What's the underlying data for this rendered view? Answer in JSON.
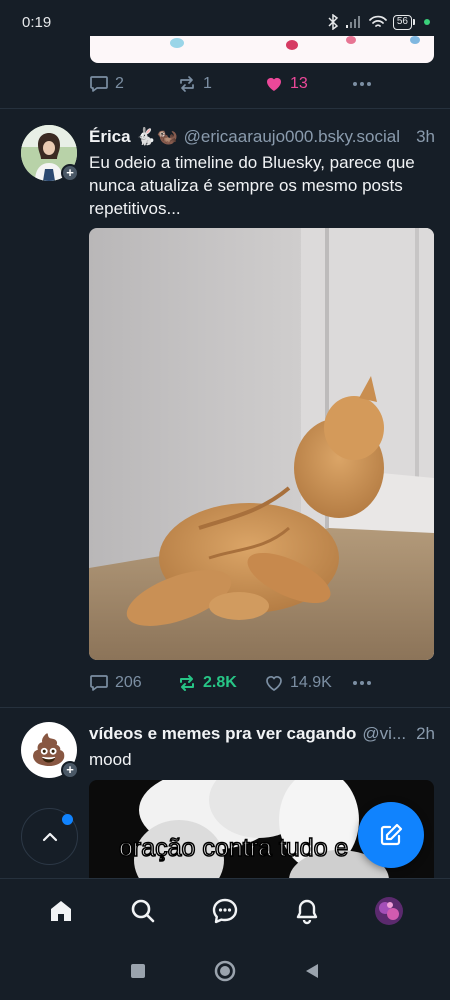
{
  "status_bar": {
    "time": "0:19",
    "battery": "56",
    "icons": [
      "bluetooth-icon",
      "signal-icon",
      "wifi-icon",
      "battery-icon"
    ]
  },
  "previous_post": {
    "replies": "2",
    "reposts": "1",
    "likes": "13",
    "liked": true
  },
  "post1": {
    "display_name": "Érica 🐇🦦",
    "handle": "@ericaaraujo000.bsky.social",
    "timestamp": "3h",
    "text": "Eu odeio a timeline do Bluesky, parece que nunca atualiza é sempre os mesmo posts repetitivos...",
    "media": "orange-cat-gif",
    "replies": "206",
    "reposts": "2.8K",
    "reposted": true,
    "likes": "14.9K"
  },
  "post2": {
    "display_name": "vídeos e memes pra ver cagando",
    "handle": "@vi...",
    "timestamp": "2h",
    "avatar_emoji": "💩",
    "text": "mood",
    "media_caption": "oração contra tudo e"
  },
  "bottom_nav": [
    "home-icon",
    "search-icon",
    "chat-icon",
    "notifications-icon",
    "profile-avatar"
  ],
  "colors": {
    "background": "#161e27",
    "accent": "#1083fe",
    "like": "#ec4899",
    "repost": "#27c586",
    "muted": "#7c8fa3"
  }
}
